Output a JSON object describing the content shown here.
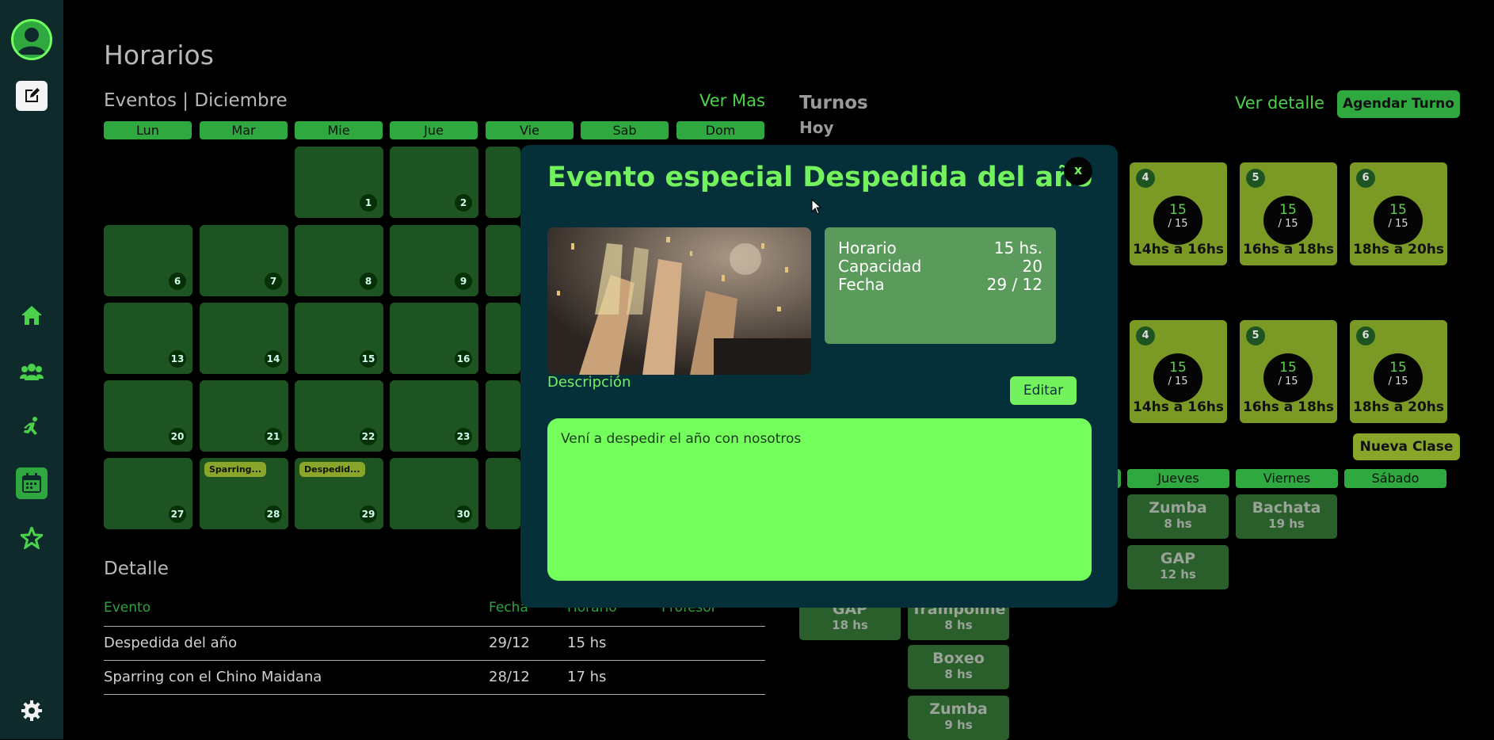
{
  "sidebar": {
    "icons": [
      "user-icon",
      "edit-icon",
      "home-icon",
      "group-icon",
      "runner-icon",
      "calendar-icon",
      "star-icon",
      "gear-icon"
    ]
  },
  "page": {
    "title": "Horarios"
  },
  "eventos": {
    "heading": "Eventos | Diciembre",
    "ver_mas": "Ver Mas",
    "days": [
      "Lun",
      "Mar",
      "Mie",
      "Jue",
      "Vie",
      "Sab",
      "Dom"
    ],
    "rows": [
      [
        null,
        null,
        "1",
        "2"
      ],
      [
        "6",
        "7",
        "8",
        "9"
      ],
      [
        "13",
        "14",
        "15",
        "16"
      ],
      [
        "20",
        "21",
        "22",
        "23"
      ],
      [
        "27",
        "28",
        "29",
        "30"
      ]
    ],
    "tags": {
      "28": "Sparring...",
      "29": "Despedid..."
    }
  },
  "detalle": {
    "heading": "Detalle",
    "columns": [
      "Evento",
      "Fecha",
      "Horario",
      "Profesor"
    ],
    "rows": [
      {
        "evento": "Despedida del año",
        "fecha": "29/12",
        "horario": "15 hs",
        "profesor": ""
      },
      {
        "evento": "Sparring con el Chino Maidana",
        "fecha": "28/12",
        "horario": "17 hs",
        "profesor": ""
      }
    ]
  },
  "turnos": {
    "heading": "Turnos",
    "sub": "Hoy",
    "ver_detalle": "Ver detalle",
    "agendar": "Agendar Turno",
    "nueva_clase": "Nueva Clase",
    "row1": [
      {
        "badge": "4",
        "used": "15",
        "total": "/ 15",
        "range": "14hs a 16hs"
      },
      {
        "badge": "5",
        "used": "15",
        "total": "/ 15",
        "range": "16hs a 18hs"
      },
      {
        "badge": "6",
        "used": "15",
        "total": "/ 15",
        "range": "18hs a 20hs"
      }
    ],
    "row2": [
      {
        "badge": "4",
        "used": "15",
        "total": "/ 15",
        "range": "14hs a 16hs"
      },
      {
        "badge": "5",
        "used": "15",
        "total": "/ 15",
        "range": "16hs a 18hs"
      },
      {
        "badge": "6",
        "used": "15",
        "total": "/ 15",
        "range": "18hs a 20hs"
      }
    ],
    "weekdays": [
      "Jueves",
      "Viernes",
      "Sábado"
    ],
    "clases": {
      "jueves": [
        {
          "name": "Zumba",
          "hour": "8 hs"
        },
        {
          "name": "GAP",
          "hour": "12 hs"
        }
      ],
      "viernes": [
        {
          "name": "Bachata",
          "hour": "19 hs"
        }
      ],
      "col1": [
        {
          "name": "GAP",
          "hour": "18 hs"
        }
      ],
      "col2": [
        {
          "name": "Trampoline",
          "hour": "8 hs"
        },
        {
          "name": "Boxeo",
          "hour": "8 hs"
        },
        {
          "name": "Zumba",
          "hour": "9 hs"
        }
      ]
    }
  },
  "modal": {
    "title": "Evento especial Despedida del año",
    "close": "x",
    "horario_label": "Horario",
    "horario_value": "15 hs.",
    "capacidad_label": "Capacidad",
    "capacidad_value": "20",
    "fecha_label": "Fecha",
    "fecha_value": "29 / 12",
    "desc_label": "Descripción",
    "edit": "Editar",
    "description": "Vení a despedir el año con nosotros"
  }
}
